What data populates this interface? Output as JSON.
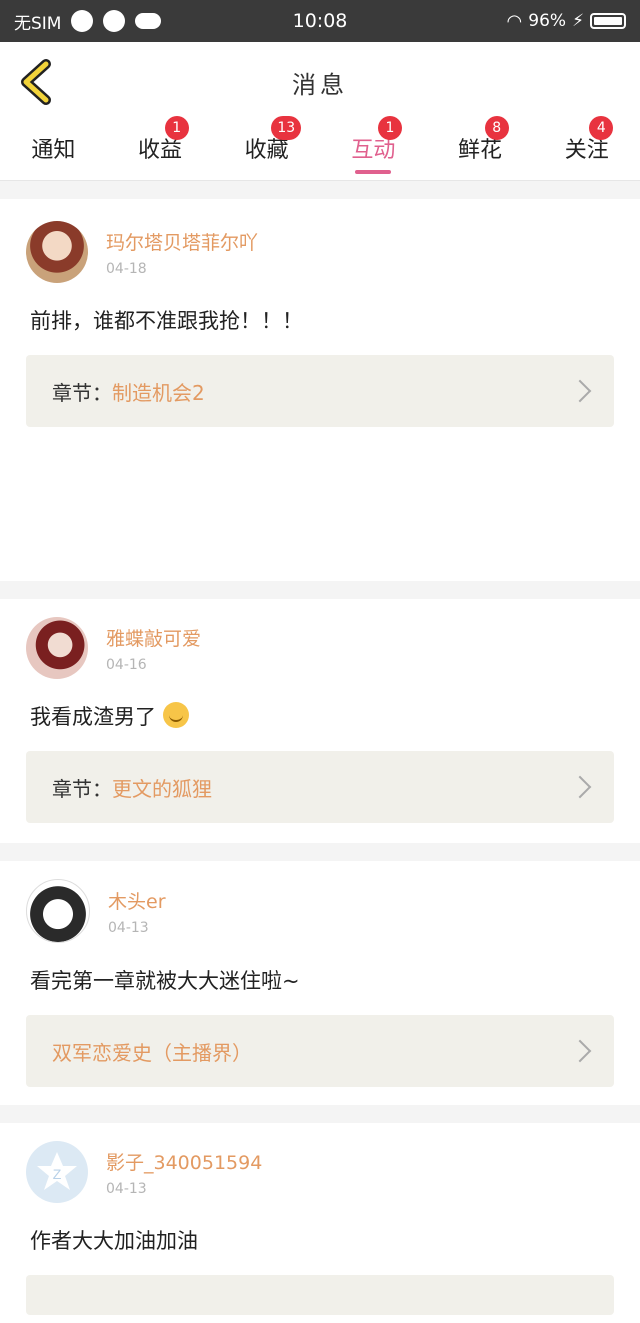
{
  "status_bar": {
    "carrier": "无SIM",
    "time": "10:08",
    "battery": "96%"
  },
  "header": {
    "title": "消息"
  },
  "tabs": [
    {
      "label": "通知",
      "badge": ""
    },
    {
      "label": "收益",
      "badge": "1"
    },
    {
      "label": "收藏",
      "badge": "13"
    },
    {
      "label": "互动",
      "badge": "1",
      "active": true
    },
    {
      "label": "鲜花",
      "badge": "8"
    },
    {
      "label": "关注",
      "badge": "4"
    }
  ],
  "messages": [
    {
      "username": "玛尔塔贝塔菲尔吖",
      "date": "04-18",
      "content": "前排，谁都不准跟我抢！！！",
      "ref_label": "章节：",
      "ref_value": "制造机会2"
    },
    {
      "username": "雅蝶敲可爱",
      "date": "04-16",
      "content": "我看成渣男了",
      "ref_label": "章节：",
      "ref_value": "更文的狐狸"
    },
    {
      "username": "木头er",
      "date": "04-13",
      "content": "看完第一章就被大大迷住啦~",
      "ref_label": "",
      "ref_value": "双军恋爱史（主播界）"
    },
    {
      "username": "影子_340051594",
      "date": "04-13",
      "content": "作者大大加油加油"
    }
  ],
  "colors": {
    "accent": "#e0608e",
    "username": "#e39a62",
    "badge": "#e8333f",
    "back_icon": "#f2d33a"
  }
}
